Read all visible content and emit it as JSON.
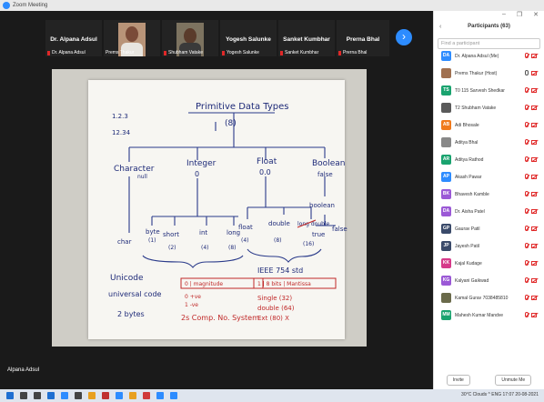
{
  "window": {
    "title": "Zoom Meeting"
  },
  "video_strip": {
    "participants": [
      {
        "name": "Dr. Alpana Adsul",
        "sub": "Dr. Alpana Adsul"
      },
      {
        "name": "",
        "sub": "Prems Thakur",
        "has_photo": true
      },
      {
        "name": "",
        "sub": "Shubham Vatake",
        "has_photo": true
      },
      {
        "name": "Yogesh Salunke",
        "sub": "Yogesh Salunke"
      },
      {
        "name": "Sanket Kumbhar",
        "sub": "Sanket Kumbhar"
      },
      {
        "name": "Prerna Bhal",
        "sub": "Prerna Bhal"
      }
    ]
  },
  "speaker_label": "Alpana Adsul",
  "whiteboard": {
    "title": "Primitive Data Types",
    "count": "(8)",
    "date1": "1.2.3",
    "date2": "12.34",
    "char_label": "Character",
    "char_sub": "null",
    "int_label": "Integer",
    "int_sub": "0",
    "float_label": "Float",
    "float_sub": "0.0",
    "bool_label": "Boolean",
    "bool_sub": "false",
    "byte": "byte",
    "byte_n": "(1)",
    "short": "short",
    "short_n": "(2)",
    "int": "int",
    "int_n": "(4)",
    "long": "long",
    "long_n": "(8)",
    "float": "float",
    "float_n": "(4)",
    "double": "double",
    "double_n": "(8)",
    "ldouble": "long double",
    "ldouble_n": "(16)",
    "boolean": "boolean",
    "char": "char",
    "true": "true",
    "false2": "false",
    "unicode": "Unicode",
    "uni_code": "universal code",
    "two_bytes": "2 bytes",
    "magnitude": "0 | magnitude",
    "plus_ve": "0 +ve",
    "minus_ve": "1 -ve",
    "comp": "2s Comp. No. System",
    "ieee": "IEEE 754 std",
    "mantissa": "1 | 8 bits | Mantissa",
    "single": "Single (32)",
    "double2": "double (64)",
    "ext": "Ext (80) X"
  },
  "panel": {
    "title": "Participants (63)",
    "search_placeholder": "Find a participant",
    "participants": [
      {
        "name": "Dr. Alpana Adsul (Me)",
        "initials": "DA",
        "color": "#2d8cff",
        "muted": true,
        "cam_off": true
      },
      {
        "name": "Prems Thakur (Host)",
        "initials": "",
        "color": "#a07050",
        "photo": true,
        "muted": false,
        "cam_off": true
      },
      {
        "name": "T0 115 Sarvesh Shedkar",
        "initials": "TS",
        "color": "#1aa36f",
        "muted": true,
        "cam_off": true
      },
      {
        "name": "T2 Shubham Vatake",
        "initials": "",
        "color": "#5a5a5a",
        "photo": true,
        "muted": true,
        "cam_off": true
      },
      {
        "name": "Adi Bhosale",
        "initials": "AB",
        "color": "#f07a1c",
        "muted": true,
        "cam_off": true
      },
      {
        "name": "Aditya Bhal",
        "initials": "",
        "color": "#888",
        "photo": true,
        "muted": true,
        "cam_off": true
      },
      {
        "name": "Aditya Rathod",
        "initials": "AR",
        "color": "#1aa36f",
        "muted": true,
        "cam_off": true
      },
      {
        "name": "Akash Pawar",
        "initials": "AP",
        "color": "#2d8cff",
        "muted": true,
        "cam_off": true
      },
      {
        "name": "Bhavesh Kamble",
        "initials": "BK",
        "color": "#9b59d6",
        "muted": true,
        "cam_off": true
      },
      {
        "name": "Dr. Aisha Patel",
        "initials": "DA",
        "color": "#9b59d6",
        "muted": true,
        "cam_off": true
      },
      {
        "name": "Gaurav Patil",
        "initials": "GP",
        "color": "#3a4a6a",
        "muted": true,
        "cam_off": true
      },
      {
        "name": "Jayesh Patil",
        "initials": "JP",
        "color": "#3a4a6a",
        "muted": true,
        "cam_off": true
      },
      {
        "name": "Kajal Kudage",
        "initials": "KK",
        "color": "#d63a8a",
        "muted": true,
        "cam_off": true
      },
      {
        "name": "Kalyani Gaikwad",
        "initials": "KG",
        "color": "#9b59d6",
        "muted": true,
        "cam_off": true
      },
      {
        "name": "Kamal Gurav 7038485810",
        "initials": "",
        "color": "#6a6a4a",
        "photo": true,
        "muted": true,
        "cam_off": true
      },
      {
        "name": "Mahesh Kumar Mandve",
        "initials": "MM",
        "color": "#1aa36f",
        "muted": true,
        "cam_off": true
      }
    ],
    "invite_label": "Invite",
    "unmute_label": "Unmute Me"
  },
  "taskbar": {
    "tray_text": "30°C  Clouds  ^  ENG  17:07  20-08-2021",
    "icon_colors": [
      "#1f6fd1",
      "#444",
      "#444",
      "#1f6fd1",
      "#2d8cff",
      "#444",
      "#e8a020",
      "#c03030",
      "#2d8cff",
      "#e8a020",
      "#d03a3a",
      "#2d8cff",
      "#2d8cff"
    ]
  }
}
